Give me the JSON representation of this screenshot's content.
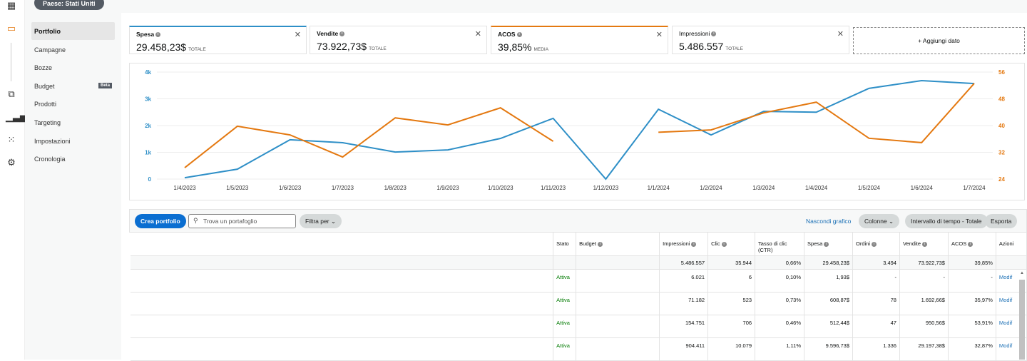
{
  "country_pill": "Paese: Stati Uniti",
  "rail_icons": [
    "dashboard-icon",
    "wallet-icon",
    "media-icon",
    "reports-icon",
    "apps-grid-icon",
    "gear-icon"
  ],
  "subnav": [
    {
      "label": "Portfolio",
      "selected": true
    },
    {
      "label": "Campagne"
    },
    {
      "label": "Bozze"
    },
    {
      "label": "Budget",
      "badge": "Beta"
    },
    {
      "label": "Prodotti"
    },
    {
      "label": "Targeting"
    },
    {
      "label": "Impostazioni"
    },
    {
      "label": "Cronologia"
    }
  ],
  "metrics": [
    {
      "title": "Spesa",
      "value": "29.458,23$",
      "suffix": "TOTALE",
      "color": "#2e8fc7"
    },
    {
      "title": "Vendite",
      "value": "73.922,73$",
      "suffix": "TOTALE",
      "color": ""
    },
    {
      "title": "ACOS",
      "value": "39,85%",
      "suffix": "MEDIA",
      "color": "#e47911"
    },
    {
      "title": "Impressioni",
      "value": "5.486.557",
      "suffix": "TOTALE",
      "color": ""
    }
  ],
  "add_metric": "+ Aggiungi dato",
  "chart_data": {
    "type": "line",
    "categories": [
      "1/4/2023",
      "1/5/2023",
      "1/6/2023",
      "1/7/2023",
      "1/8/2023",
      "1/9/2023",
      "1/10/2023",
      "1/11/2023",
      "1/12/2023",
      "1/1/2024",
      "1/2/2024",
      "1/3/2024",
      "1/4/2024",
      "1/5/2024",
      "1/6/2024",
      "1/7/2024"
    ],
    "y_left": {
      "ticks": [
        "0",
        "1k",
        "2k",
        "3k",
        "4k"
      ],
      "range": [
        0,
        4000
      ],
      "color": "#2e8fc7"
    },
    "y_right": {
      "ticks": [
        "24",
        "32",
        "40",
        "48",
        "56"
      ],
      "range": [
        24,
        56
      ],
      "color": "#e47911"
    },
    "grid": true,
    "series": [
      {
        "name": "Spesa",
        "axis": "left",
        "color": "#2e8fc7",
        "values": [
          50,
          370,
          1470,
          1360,
          1010,
          1090,
          1520,
          2270,
          0,
          2610,
          1650,
          2530,
          2500,
          3390,
          3680,
          3570
        ]
      },
      {
        "name": "ACOS",
        "axis": "right",
        "color": "#e47911",
        "values": [
          27.4,
          39.8,
          37.2,
          30.6,
          42.3,
          40.2,
          45.3,
          35.3,
          null,
          38.0,
          38.7,
          43.8,
          47.0,
          36.2,
          34.9,
          52.6
        ]
      }
    ]
  },
  "toolbar": {
    "create": "Crea portfolio",
    "search_placeholder": "Trova un portafoglio",
    "filter": "Filtra per",
    "hide_chart": "Nascondi grafico",
    "columns": "Colonne",
    "range": "Intervallo di tempo - Totale",
    "export": "Esporta"
  },
  "table": {
    "headers": [
      "",
      "Stato",
      "Budget",
      "Impressioni",
      "Clic",
      "Tasso di clic (CTR)",
      "Spesa",
      "Ordini",
      "Vendite",
      "ACOS",
      "Azioni"
    ],
    "totals": [
      "",
      "",
      "",
      "5.486.557",
      "35.944",
      "0,66%",
      "29.458,23$",
      "3.494",
      "73.922,73$",
      "39,85%",
      ""
    ],
    "rows": [
      [
        "",
        "Attiva",
        "",
        "6.021",
        "6",
        "0,10%",
        "1,93$",
        "-",
        "-",
        "-",
        "Modif"
      ],
      [
        "",
        "Attiva",
        "",
        "71.182",
        "523",
        "0,73%",
        "608,87$",
        "78",
        "1.692,66$",
        "35,97%",
        "Modif"
      ],
      [
        "",
        "Attiva",
        "",
        "154.751",
        "706",
        "0,46%",
        "512,44$",
        "47",
        "950,56$",
        "53,91%",
        "Modif"
      ],
      [
        "",
        "Attiva",
        "",
        "904.411",
        "10.079",
        "1,11%",
        "9.596,73$",
        "1.336",
        "29.197,38$",
        "32,87%",
        "Modif"
      ]
    ]
  }
}
